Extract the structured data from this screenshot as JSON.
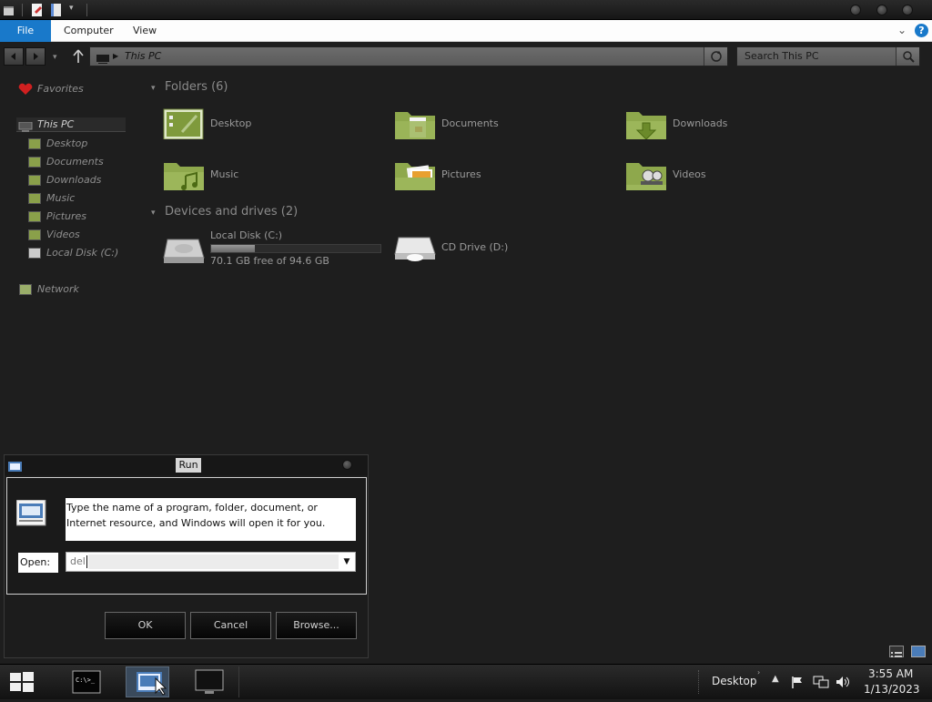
{
  "ribbon": {
    "tabs": [
      "File",
      "Computer",
      "View"
    ]
  },
  "address": {
    "location": "This PC",
    "search_placeholder": "Search This PC"
  },
  "sidebar": {
    "favorites": "Favorites",
    "this_pc": "This PC",
    "items": [
      "Desktop",
      "Documents",
      "Downloads",
      "Music",
      "Pictures",
      "Videos",
      "Local Disk (C:)"
    ],
    "network": "Network"
  },
  "main": {
    "folders_header": "Folders (6)",
    "folders": [
      "Desktop",
      "Documents",
      "Downloads",
      "Music",
      "Pictures",
      "Videos"
    ],
    "devices_header": "Devices and drives (2)",
    "drives": [
      {
        "name": "Local Disk (C:)",
        "free": "70.1 GB free of 94.6 GB",
        "used_fraction": 0.26
      },
      {
        "name": "CD Drive (D:)"
      }
    ]
  },
  "run_dialog": {
    "title": "Run",
    "description_line1": "Type the name of a program, folder, document, or",
    "description_line2": "Internet resource, and Windows will open it for you.",
    "open_label": "Open:",
    "input_value": "del",
    "ok": "OK",
    "cancel": "Cancel",
    "browse": "Browse..."
  },
  "taskbar": {
    "desktop_label": "Desktop",
    "time": "3:55 AM",
    "date": "1/13/2023"
  },
  "colors": {
    "accent": "#1979ca",
    "folder_green": "#8aa04a",
    "background": "#1e1e1e"
  }
}
